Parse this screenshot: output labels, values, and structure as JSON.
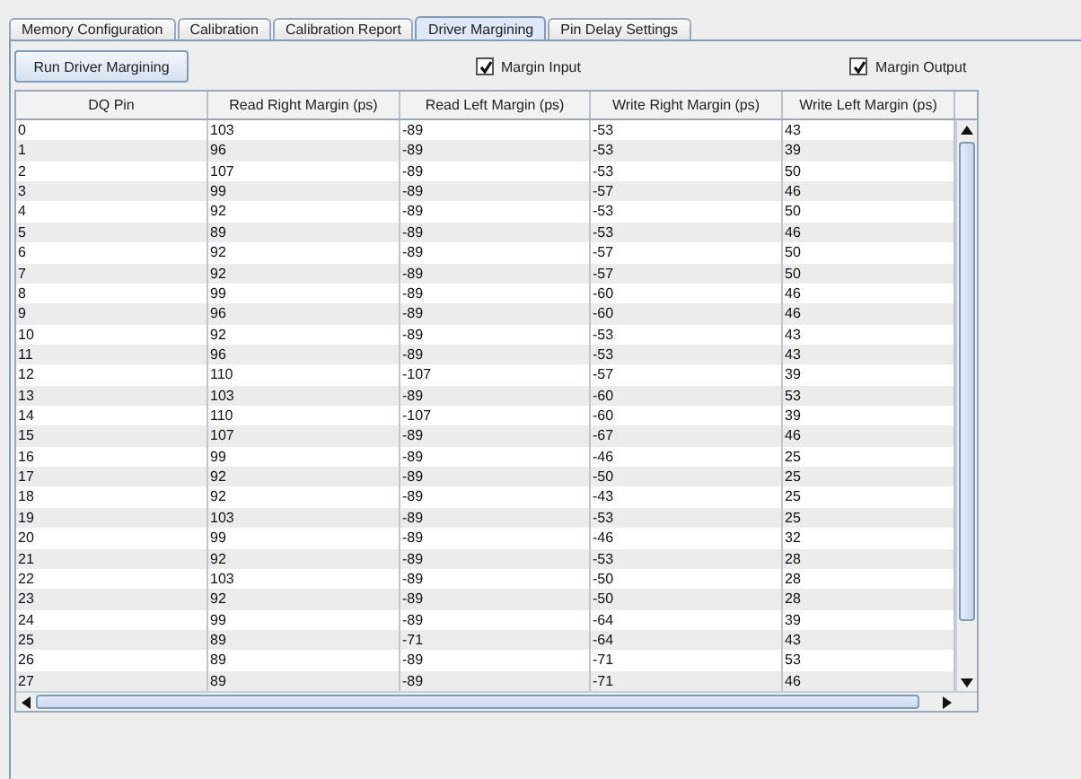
{
  "tabs": [
    {
      "label": "Memory Configuration",
      "selected": false
    },
    {
      "label": "Calibration",
      "selected": false
    },
    {
      "label": "Calibration Report",
      "selected": false
    },
    {
      "label": "Driver Margining",
      "selected": true
    },
    {
      "label": "Pin Delay Settings",
      "selected": false
    }
  ],
  "run_button": "Run Driver Margining",
  "checkboxes": [
    {
      "label": "Margin Input",
      "checked": true
    },
    {
      "label": "Margin Output",
      "checked": true
    }
  ],
  "table": {
    "columns": [
      "DQ Pin",
      "Read Right Margin (ps)",
      "Read Left Margin (ps)",
      "Write Right Margin (ps)",
      "Write Left Margin (ps)"
    ],
    "rows": [
      [
        "0",
        "103",
        "-89",
        "-53",
        "43"
      ],
      [
        "1",
        "96",
        "-89",
        "-53",
        "39"
      ],
      [
        "2",
        "107",
        "-89",
        "-53",
        "50"
      ],
      [
        "3",
        "99",
        "-89",
        "-57",
        "46"
      ],
      [
        "4",
        "92",
        "-89",
        "-53",
        "50"
      ],
      [
        "5",
        "89",
        "-89",
        "-53",
        "46"
      ],
      [
        "6",
        "92",
        "-89",
        "-57",
        "50"
      ],
      [
        "7",
        "92",
        "-89",
        "-57",
        "50"
      ],
      [
        "8",
        "99",
        "-89",
        "-60",
        "46"
      ],
      [
        "9",
        "96",
        "-89",
        "-60",
        "46"
      ],
      [
        "10",
        "92",
        "-89",
        "-53",
        "43"
      ],
      [
        "11",
        "96",
        "-89",
        "-53",
        "43"
      ],
      [
        "12",
        "110",
        "-107",
        "-57",
        "39"
      ],
      [
        "13",
        "103",
        "-89",
        "-60",
        "53"
      ],
      [
        "14",
        "110",
        "-107",
        "-60",
        "39"
      ],
      [
        "15",
        "107",
        "-89",
        "-67",
        "46"
      ],
      [
        "16",
        "99",
        "-89",
        "-46",
        "25"
      ],
      [
        "17",
        "92",
        "-89",
        "-50",
        "25"
      ],
      [
        "18",
        "92",
        "-89",
        "-43",
        "25"
      ],
      [
        "19",
        "103",
        "-89",
        "-53",
        "25"
      ],
      [
        "20",
        "99",
        "-89",
        "-46",
        "32"
      ],
      [
        "21",
        "92",
        "-89",
        "-53",
        "28"
      ],
      [
        "22",
        "103",
        "-89",
        "-50",
        "28"
      ],
      [
        "23",
        "92",
        "-89",
        "-50",
        "28"
      ],
      [
        "24",
        "99",
        "-89",
        "-64",
        "39"
      ],
      [
        "25",
        "89",
        "-71",
        "-64",
        "43"
      ],
      [
        "26",
        "89",
        "-89",
        "-71",
        "53"
      ],
      [
        "27",
        "89",
        "-89",
        "-71",
        "46"
      ]
    ]
  }
}
